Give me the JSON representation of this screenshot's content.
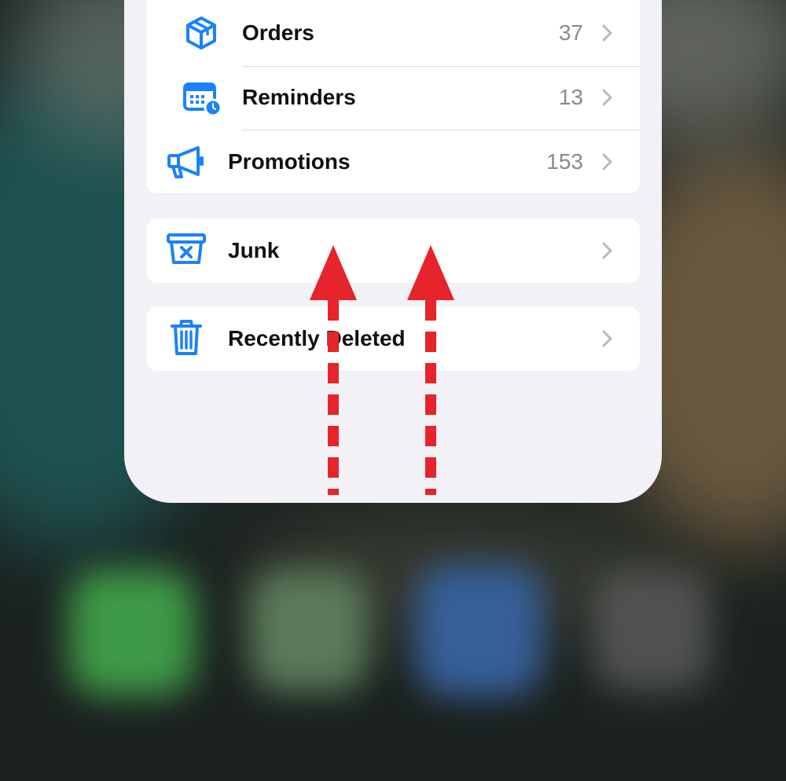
{
  "mailboxes": {
    "group1": [
      {
        "label": "Orders",
        "count": "37",
        "icon": "package-icon"
      },
      {
        "label": "Reminders",
        "count": "13",
        "icon": "calendar-clock-icon"
      },
      {
        "label": "Promotions",
        "count": "153",
        "icon": "megaphone-icon"
      }
    ],
    "junk": {
      "label": "Junk",
      "icon": "junk-box-icon"
    },
    "recently_deleted": {
      "label": "Recently Deleted",
      "icon": "trash-icon"
    }
  },
  "colors": {
    "accent": "#1a82fb",
    "annotation": "#e5242b"
  },
  "annotation": {
    "type": "swipe-up-arrows",
    "count": 2
  }
}
